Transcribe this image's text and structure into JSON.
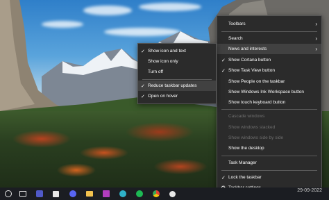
{
  "wallpaper": {
    "description_icon": "yosemite-landscape"
  },
  "context_menu": {
    "items": [
      {
        "label": "Toolbars",
        "checked": false,
        "submenu": true,
        "disabled": false
      },
      {
        "label": "Search",
        "checked": false,
        "submenu": true,
        "disabled": false
      },
      {
        "label": "News and interests",
        "checked": false,
        "submenu": true,
        "disabled": false,
        "highlight": true
      },
      {
        "label": "Show Cortana button",
        "checked": true,
        "submenu": false,
        "disabled": false
      },
      {
        "label": "Show Task View button",
        "checked": true,
        "submenu": false,
        "disabled": false
      },
      {
        "label": "Show People on the taskbar",
        "checked": false,
        "submenu": false,
        "disabled": false
      },
      {
        "label": "Show Windows Ink Workspace button",
        "checked": false,
        "submenu": false,
        "disabled": false
      },
      {
        "label": "Show touch keyboard button",
        "checked": false,
        "submenu": false,
        "disabled": false
      },
      {
        "label": "Cascade windows",
        "checked": false,
        "submenu": false,
        "disabled": true
      },
      {
        "label": "Show windows stacked",
        "checked": false,
        "submenu": false,
        "disabled": true
      },
      {
        "label": "Show windows side by side",
        "checked": false,
        "submenu": false,
        "disabled": true
      },
      {
        "label": "Show the desktop",
        "checked": false,
        "submenu": false,
        "disabled": false
      },
      {
        "label": "Task Manager",
        "checked": false,
        "submenu": false,
        "disabled": false
      },
      {
        "label": "Lock the taskbar",
        "checked": true,
        "submenu": false,
        "disabled": false
      },
      {
        "label": "Taskbar settings",
        "checked": false,
        "submenu": false,
        "disabled": false,
        "icon": "gear-icon"
      }
    ]
  },
  "submenu": {
    "items": [
      {
        "label": "Show icon and text",
        "checked": true
      },
      {
        "label": "Show icon only",
        "checked": false
      },
      {
        "label": "Turn off",
        "checked": false
      },
      {
        "label": "Reduce taskbar updates",
        "checked": true,
        "highlight": true
      },
      {
        "label": "Open on hover",
        "checked": true
      }
    ]
  },
  "taskbar": {
    "icons": [
      {
        "name": "cortana-icon",
        "color": "#e8e8e8"
      },
      {
        "name": "task-view-icon",
        "color": "#e8e8e8"
      },
      {
        "name": "teams-icon",
        "color": "#5059c9"
      },
      {
        "name": "calendar-icon",
        "color": "#e8e8e8"
      },
      {
        "name": "discord-icon",
        "color": "#5865f2"
      },
      {
        "name": "file-explorer-icon",
        "color": "#f2c14e"
      },
      {
        "name": "onenote-icon",
        "color": "#b23dbd"
      },
      {
        "name": "edge-icon",
        "color": "#2fb1c9"
      },
      {
        "name": "spotify-icon",
        "color": "#1db954"
      },
      {
        "name": "chrome-icon",
        "color": "#e34133"
      },
      {
        "name": "photos-icon",
        "color": "#e8e8e8"
      }
    ],
    "date": "29-09-2022"
  },
  "colors": {
    "menu_bg": "#2b2b2b",
    "menu_border": "#555555",
    "highlight": "#414141",
    "disabled_text": "#6e6e6e",
    "taskbar_bg": "#1b1d22"
  }
}
